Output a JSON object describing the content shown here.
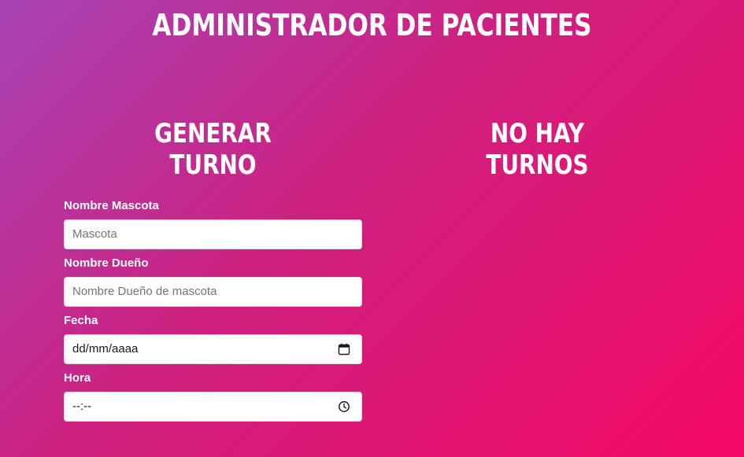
{
  "header": {
    "title": "ADMINISTRADOR DE PACIENTES"
  },
  "form_section": {
    "title": "GENERAR TURNO"
  },
  "list_section": {
    "title": "NO HAY TURNOS"
  },
  "form": {
    "fields": [
      {
        "label": "Nombre Mascota",
        "placeholder": "Mascota"
      },
      {
        "label": "Nombre Dueño",
        "placeholder": "Nombre Dueño de mascota"
      },
      {
        "label": "Fecha",
        "value": "dd/mm/aaaa",
        "icon": "calendar-icon"
      },
      {
        "label": "Hora",
        "value": "--:--",
        "icon": "clock-icon"
      }
    ]
  }
}
